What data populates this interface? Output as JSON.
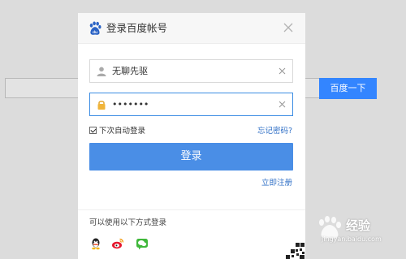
{
  "background": {
    "search_button_label": "百度一下"
  },
  "modal": {
    "title": "登录百度帐号",
    "username_value": "无聊先驱",
    "password_value": "•••••••",
    "remember_label": "下次自动登录",
    "forgot_label": "忘记密码?",
    "login_label": "登录",
    "register_label": "立即注册",
    "third_party_label": "可以使用以下方式登录",
    "social_icons": [
      "qq-icon",
      "weibo-icon",
      "wechat-icon"
    ]
  },
  "watermark": {
    "brand_text": "经验",
    "url_text": "jingyan.baidu.com"
  },
  "colors": {
    "accent": "#4a8ee6",
    "link": "#2f6fc6",
    "focus_border": "#3b8ce3"
  }
}
